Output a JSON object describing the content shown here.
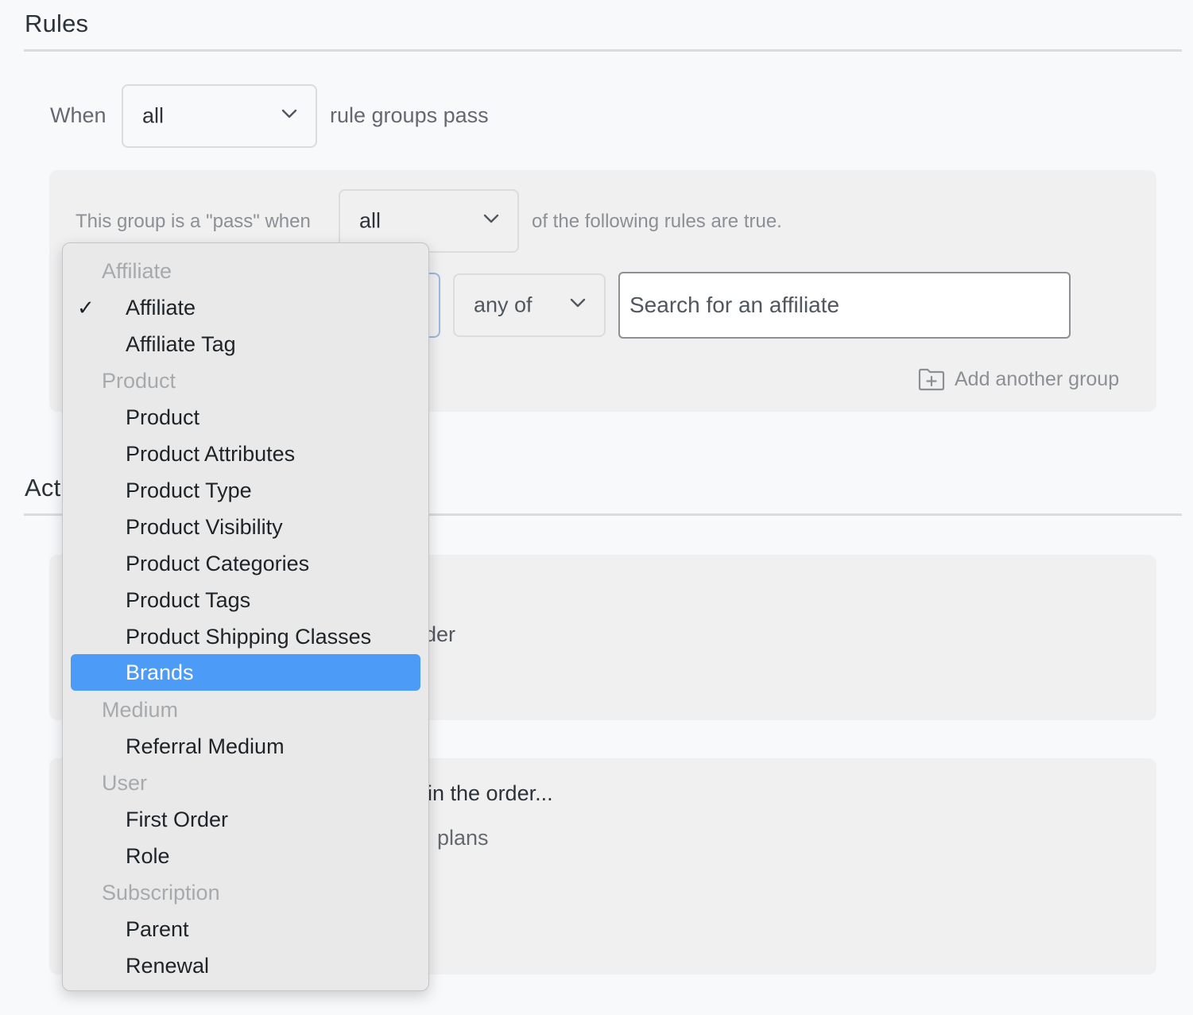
{
  "rules": {
    "title": "Rules",
    "when_label": "When",
    "when_value": "all",
    "when_suffix": "rule groups pass",
    "group": {
      "prefix": "This group is a \"pass\" when",
      "value": "all",
      "suffix": "of the following rules are true.",
      "operator": "any of",
      "search_placeholder": "Search for an affiliate",
      "add_group_label": "Add another group"
    }
  },
  "actions": {
    "title_partial": "Act",
    "fragment_1": "der",
    "fragment_2": "in the order...",
    "fragment_3": "plans"
  },
  "dropdown": {
    "selected": "Affiliate",
    "highlighted": "Brands",
    "check_glyph": "✓",
    "groups": [
      {
        "label": "Affiliate",
        "items": [
          "Affiliate",
          "Affiliate Tag"
        ]
      },
      {
        "label": "Product",
        "items": [
          "Product",
          "Product Attributes",
          "Product Type",
          "Product Visibility",
          "Product Categories",
          "Product Tags",
          "Product Shipping Classes",
          "Brands"
        ]
      },
      {
        "label": "Medium",
        "items": [
          "Referral Medium"
        ]
      },
      {
        "label": "User",
        "items": [
          "First Order",
          "Role"
        ]
      },
      {
        "label": "Subscription",
        "items": [
          "Parent",
          "Renewal"
        ]
      }
    ]
  },
  "icons": {
    "chevron": "chevron-down-icon",
    "folder_plus": "folder-plus-icon",
    "check": "checkmark-icon"
  },
  "colors": {
    "highlight": "#4c9cf7",
    "background": "#f8f9fb",
    "panel": "#f0f0f1"
  }
}
